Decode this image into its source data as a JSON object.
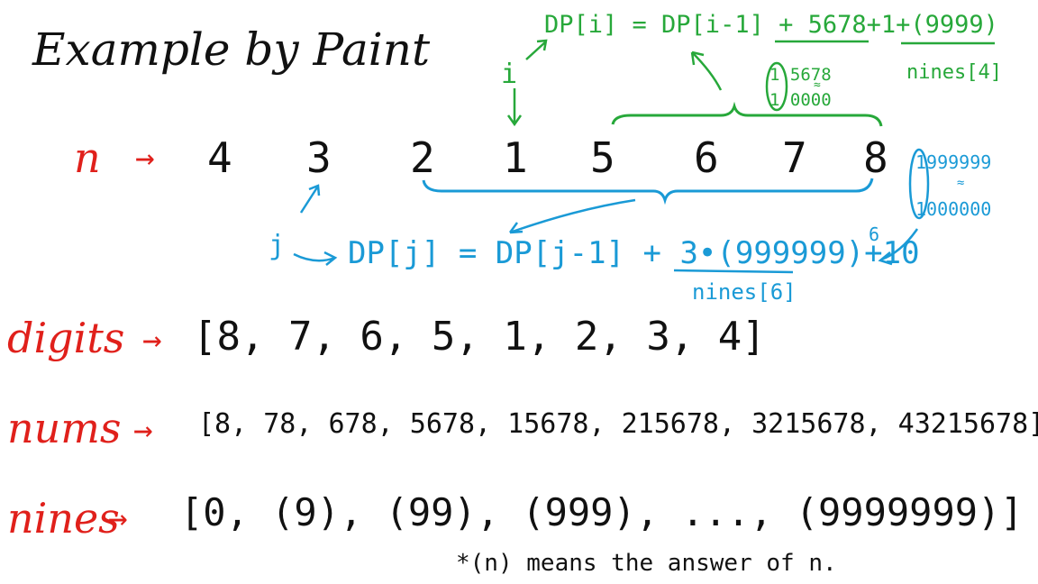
{
  "title": "Example by Paint",
  "n_row": {
    "label": "n",
    "arrow": "→",
    "digits": [
      "4",
      "3",
      "2",
      "1",
      "5",
      "6",
      "7",
      "8"
    ]
  },
  "green_note": {
    "i_label": "i",
    "formula": "DP[i] = DP[i-1] + 5678+1+(9999)",
    "nines_ref": "nines[4]",
    "side_top": "1 5678",
    "side_bottom": "1 0000",
    "approx": "≈"
  },
  "blue_note": {
    "j_label": "j",
    "formula": "DP[j] = DP[j-1] + 3•(999999)+10",
    "exponent": "6",
    "nines_ref": "nines[6]",
    "side_top": "1999999",
    "side_bottom": "1000000",
    "approx": "≈"
  },
  "digits_row": {
    "label": "digits",
    "arrow": "→",
    "values": "[8, 7, 6, 5, 1, 2, 3, 4]"
  },
  "nums_row": {
    "label": "nums",
    "arrow": "→",
    "values": "[8, 78, 678, 5678, 15678, 215678, 3215678, 43215678]"
  },
  "nines_row": {
    "label": "nines",
    "arrow": "→",
    "values": "[0, (9), (99), (999), ..., (9999999)]"
  },
  "footnote": "*(n) means the answer of n.",
  "colors": {
    "red": "#e0201b",
    "green": "#27a83a",
    "blue": "#1a9ad6",
    "ink": "#111111"
  }
}
